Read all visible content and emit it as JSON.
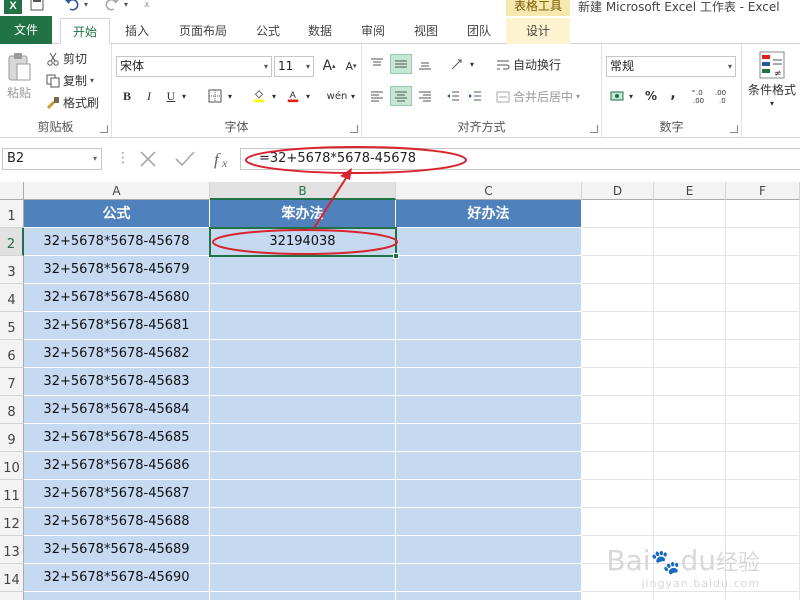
{
  "titlebar": {
    "app_icon": "X",
    "undo_icon": "undo-icon",
    "redo_icon": "redo-icon",
    "context_tab": "表格工具",
    "window_title": "新建 Microsoft Excel 工作表 - Excel"
  },
  "tabs": [
    {
      "label": "文件"
    },
    {
      "label": "开始"
    },
    {
      "label": "插入"
    },
    {
      "label": "页面布局"
    },
    {
      "label": "公式"
    },
    {
      "label": "数据"
    },
    {
      "label": "审阅"
    },
    {
      "label": "视图"
    },
    {
      "label": "团队"
    },
    {
      "label": "设计"
    }
  ],
  "ribbon": {
    "clipboard": {
      "label": "剪贴板",
      "paste": "粘贴",
      "cut": "剪切",
      "copy": "复制",
      "format_painter": "格式刷"
    },
    "font": {
      "label": "字体",
      "font_name": "宋体",
      "font_size": "11",
      "grow": "A",
      "shrink": "A",
      "bold": "B",
      "italic": "I",
      "underline": "U",
      "phonetic": "wén"
    },
    "alignment": {
      "label": "对齐方式",
      "wrap": "自动换行",
      "merge": "合并后居中"
    },
    "number": {
      "label": "数字",
      "format": "常规",
      "percent": "%",
      "comma": ","
    },
    "styles": {
      "conditional": "条件格式"
    }
  },
  "formula_bar": {
    "name_box": "B2",
    "formula": "=32+5678*5678-45678"
  },
  "columns": [
    "A",
    "B",
    "C",
    "D",
    "E",
    "F"
  ],
  "rows": [
    "1",
    "2",
    "3",
    "4",
    "5",
    "6",
    "7",
    "8",
    "9",
    "10",
    "11",
    "12",
    "13",
    "14"
  ],
  "table": {
    "headers": [
      "公式",
      "笨办法",
      "好办法"
    ],
    "rows": [
      [
        "32+5678*5678-45678",
        "32194038",
        ""
      ],
      [
        "32+5678*5678-45679",
        "",
        ""
      ],
      [
        "32+5678*5678-45680",
        "",
        ""
      ],
      [
        "32+5678*5678-45681",
        "",
        ""
      ],
      [
        "32+5678*5678-45682",
        "",
        ""
      ],
      [
        "32+5678*5678-45683",
        "",
        ""
      ],
      [
        "32+5678*5678-45684",
        "",
        ""
      ],
      [
        "32+5678*5678-45685",
        "",
        ""
      ],
      [
        "32+5678*5678-45686",
        "",
        ""
      ],
      [
        "32+5678*5678-45687",
        "",
        ""
      ],
      [
        "32+5678*5678-45688",
        "",
        ""
      ],
      [
        "32+5678*5678-45689",
        "",
        ""
      ],
      [
        "32+5678*5678-45690",
        "",
        ""
      ]
    ]
  },
  "colors": {
    "excel_green": "#217346",
    "header_blue": "#4f81bd",
    "body_blue": "#c5d9f1",
    "annotation_red": "#d9232e"
  },
  "watermark": {
    "brand": "Bai",
    "brand2": "du",
    "brand3": "经验",
    "url": "jingyan.baidu.com"
  }
}
